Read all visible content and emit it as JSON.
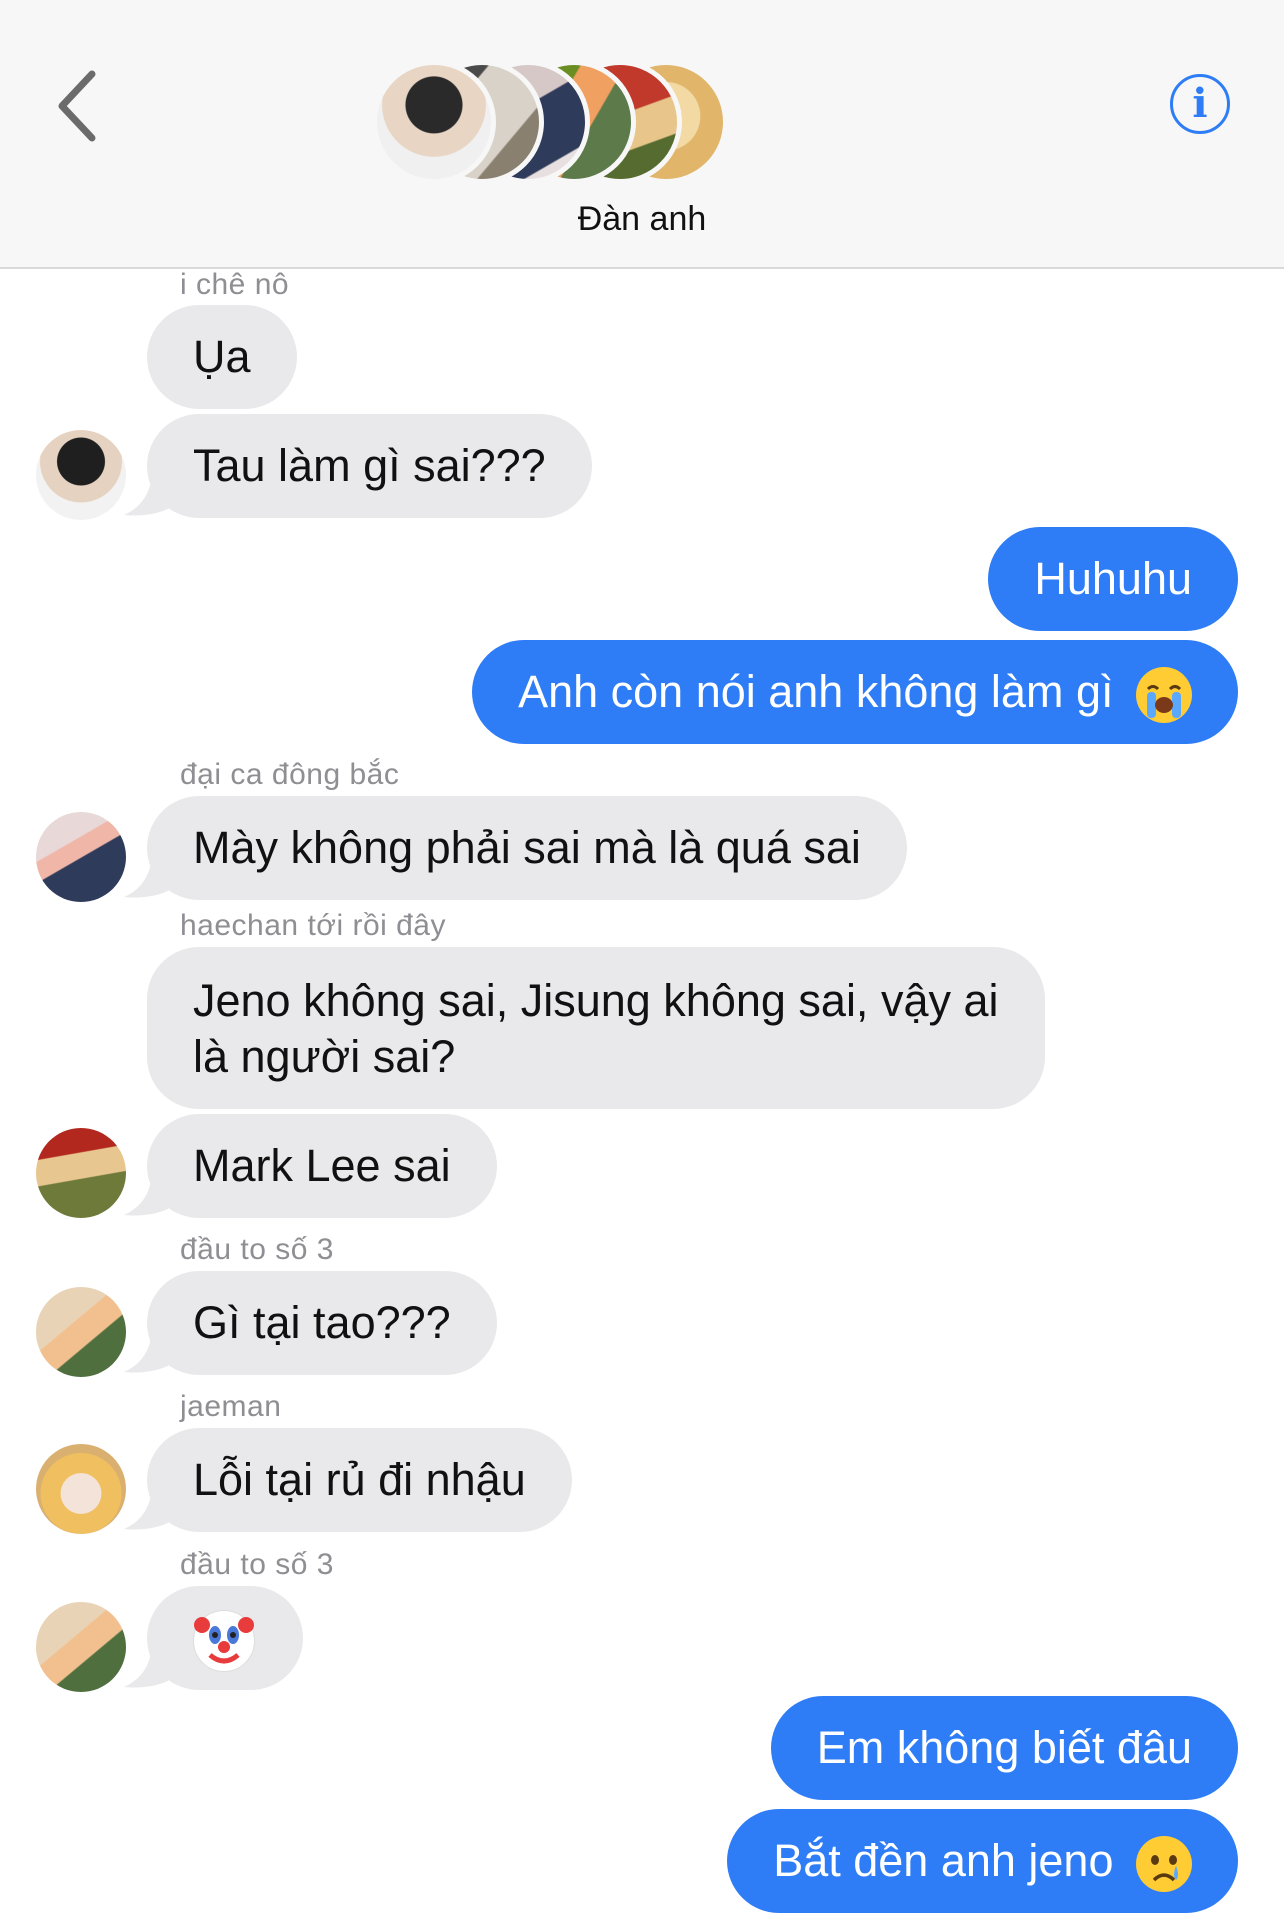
{
  "header": {
    "title": "Đàn anh",
    "back_icon": "chevron-left-icon",
    "info_icon": "info-icon",
    "info_glyph": "i",
    "accent_color": "#2e7cf6"
  },
  "messages": [
    {
      "sender": "i chê nô",
      "text": "Ụa",
      "direction": "incoming"
    },
    {
      "text": "Tau làm gì sai???",
      "direction": "incoming"
    },
    {
      "text": "Huhuhu",
      "direction": "outgoing"
    },
    {
      "text": "Anh còn nói anh không làm gì",
      "emoji": "loudly-crying-face",
      "direction": "outgoing"
    },
    {
      "sender": "đại ca đông bắc",
      "text": "Mày không phải sai mà là quá sai",
      "direction": "incoming"
    },
    {
      "sender": "haechan tới rồi đây",
      "text_line1": "Jeno không sai, Jisung không sai, vậy ai",
      "text_line2": "là người sai?",
      "direction": "incoming"
    },
    {
      "text": "Mark Lee sai",
      "direction": "incoming"
    },
    {
      "sender": "đầu to số 3",
      "text": "Gì tại tao???",
      "direction": "incoming"
    },
    {
      "sender": "jaeman",
      "text": "Lỗi tại rủ đi nhậu",
      "direction": "incoming"
    },
    {
      "sender": "đầu to số 3",
      "emoji": "clown-face",
      "direction": "incoming"
    },
    {
      "text": "Em không biết đâu",
      "direction": "outgoing"
    },
    {
      "text": "Bắt đền anh jeno",
      "emoji": "crying-face",
      "direction": "outgoing"
    }
  ],
  "colors": {
    "incoming_bubble": "#e9e9eb",
    "outgoing_bubble": "#2e7cf6",
    "sender_name": "#8e8e93"
  }
}
